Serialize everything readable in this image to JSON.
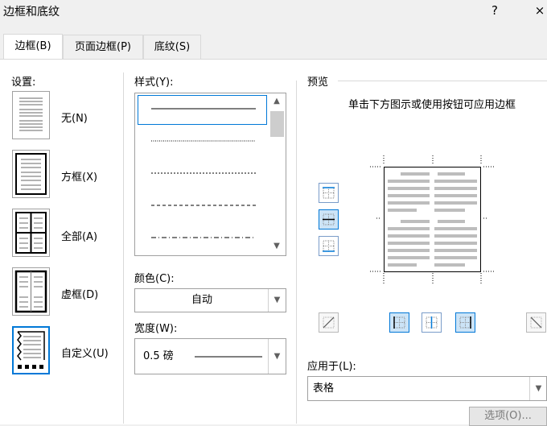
{
  "window": {
    "title": "边框和底纹",
    "help_label": "?",
    "close_label": "×"
  },
  "tabs": [
    {
      "label": "边框(B)"
    },
    {
      "label": "页面边框(P)"
    },
    {
      "label": "底纹(S)"
    }
  ],
  "settings": {
    "heading": "设置:",
    "items": [
      {
        "label": "无(N)"
      },
      {
        "label": "方框(X)"
      },
      {
        "label": "全部(A)"
      },
      {
        "label": "虚框(D)"
      },
      {
        "label": "自定义(U)"
      }
    ]
  },
  "style": {
    "heading": "样式(Y):"
  },
  "color": {
    "heading": "颜色(C):",
    "value": "自动"
  },
  "width": {
    "heading": "宽度(W):",
    "value": "0.5 磅"
  },
  "preview": {
    "heading": "预览",
    "hint": "单击下方图示或使用按钮可应用边框"
  },
  "apply_to": {
    "heading": "应用于(L):",
    "value": "表格"
  },
  "options_button": {
    "label": "选项(O)..."
  },
  "colors": {
    "accent": "#0078d7",
    "selected_fill": "#cce4f7"
  }
}
